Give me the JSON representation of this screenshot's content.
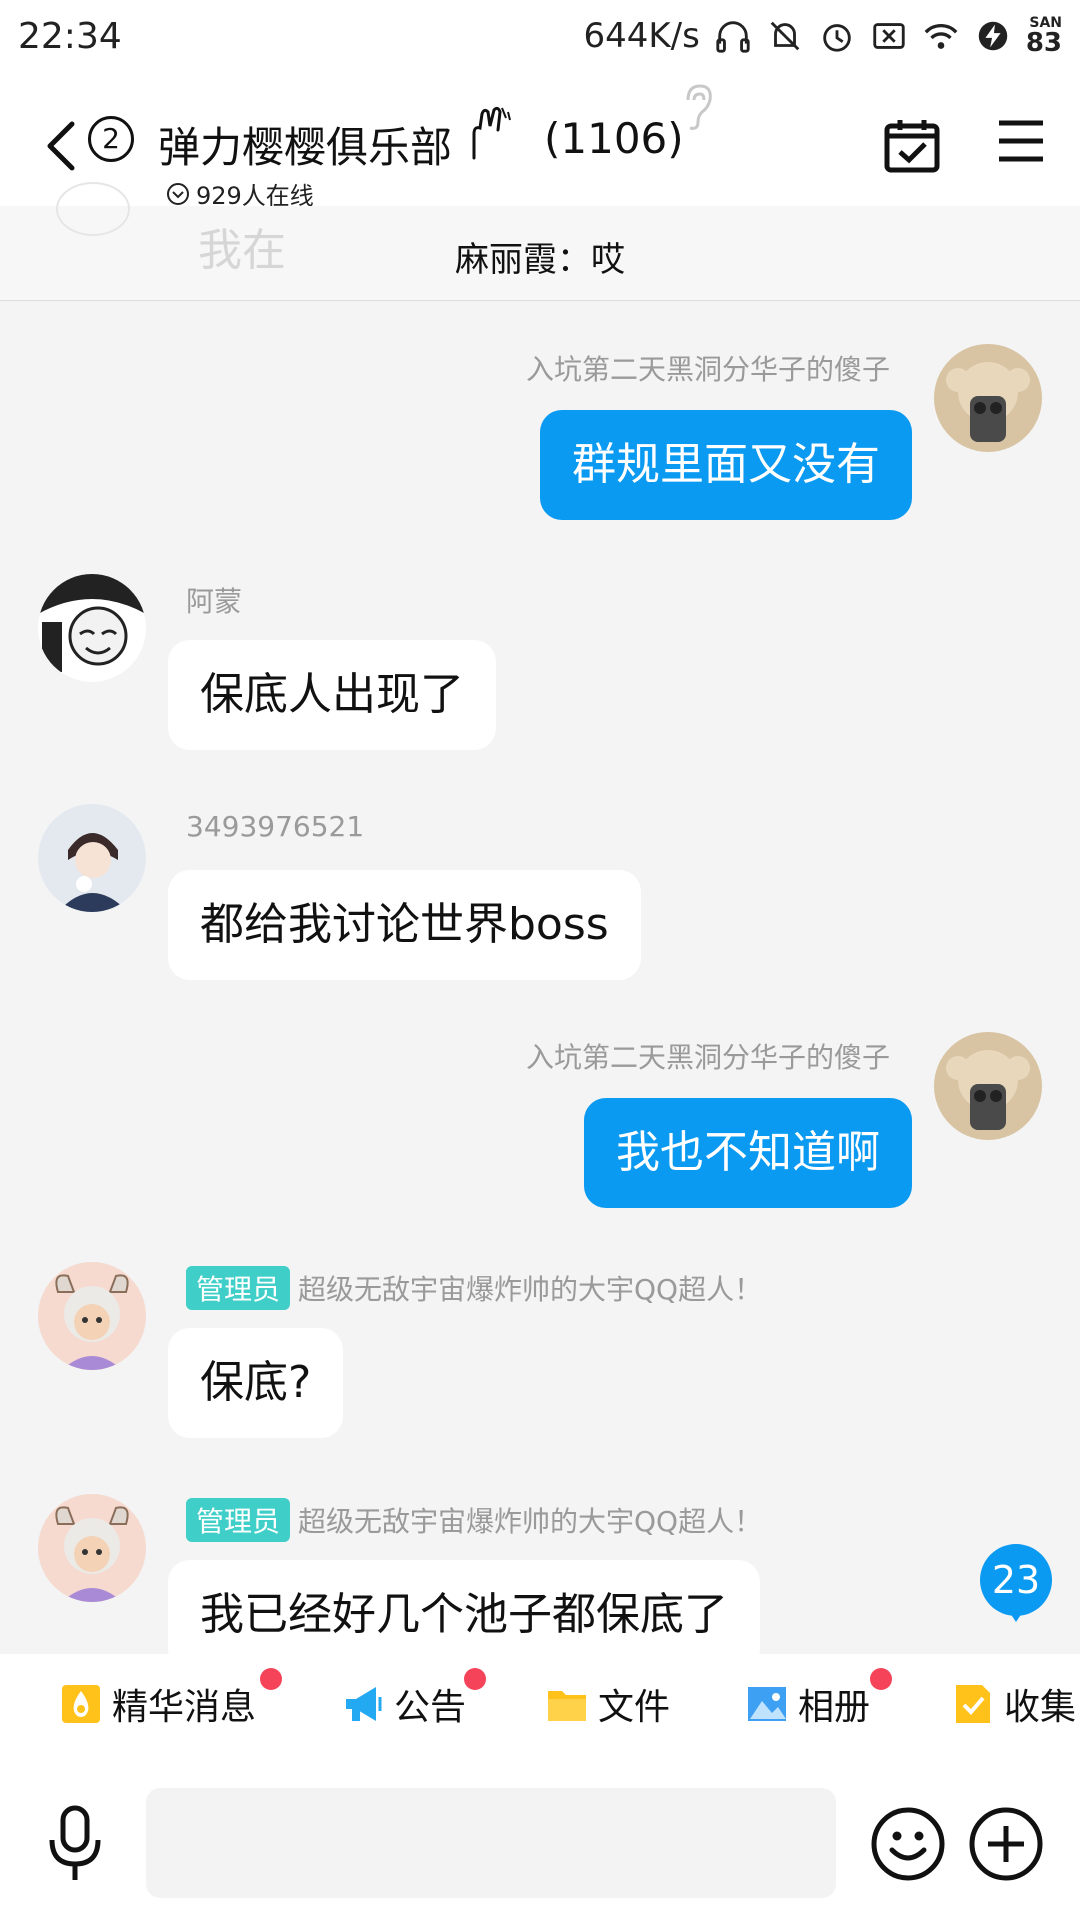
{
  "status_bar": {
    "time": "22:34",
    "speed": "644K/s",
    "battery_label": "SAN",
    "battery_level": "83"
  },
  "header": {
    "unread_count": "2",
    "group_name": "弹力樱樱俱乐部",
    "member_count": "(1106)",
    "online_text": "929人在线"
  },
  "pinned": {
    "ghost_text": "我在",
    "text": "麻丽霞：哎"
  },
  "messages": [
    {
      "sender": "入坑第二天黑洞分华子的傻子",
      "text": "群规里面又没有",
      "mine": true
    },
    {
      "sender": "阿蒙",
      "text": "保底人出现了",
      "mine": false
    },
    {
      "sender": "3493976521",
      "text": "都给我讨论世界boss",
      "mine": false
    },
    {
      "sender": "入坑第二天黑洞分华子的傻子",
      "text": "我也不知道啊",
      "mine": true
    },
    {
      "badge": "管理员",
      "sender": "超级无敌宇宙爆炸帅的大宇QQ超人！",
      "text": "保底?",
      "mine": false
    },
    {
      "badge": "管理员",
      "sender": "超级无敌宇宙爆炸帅的大宇QQ超人！",
      "text": "我已经好几个池子都保底了",
      "mine": false
    }
  ],
  "unread_new": "23",
  "quick_bar": {
    "items": [
      {
        "label": "精华消息",
        "icon": "essence-icon"
      },
      {
        "label": "公告",
        "icon": "megaphone-icon"
      },
      {
        "label": "文件",
        "icon": "folder-icon"
      },
      {
        "label": "相册",
        "icon": "photo-icon"
      },
      {
        "label": "收集",
        "icon": "collect-icon"
      }
    ]
  },
  "input": {
    "placeholder": ""
  },
  "colors": {
    "accent": "#0a9af2",
    "admin_badge": "#3fcfc8",
    "red_dot": "#f5435a"
  }
}
